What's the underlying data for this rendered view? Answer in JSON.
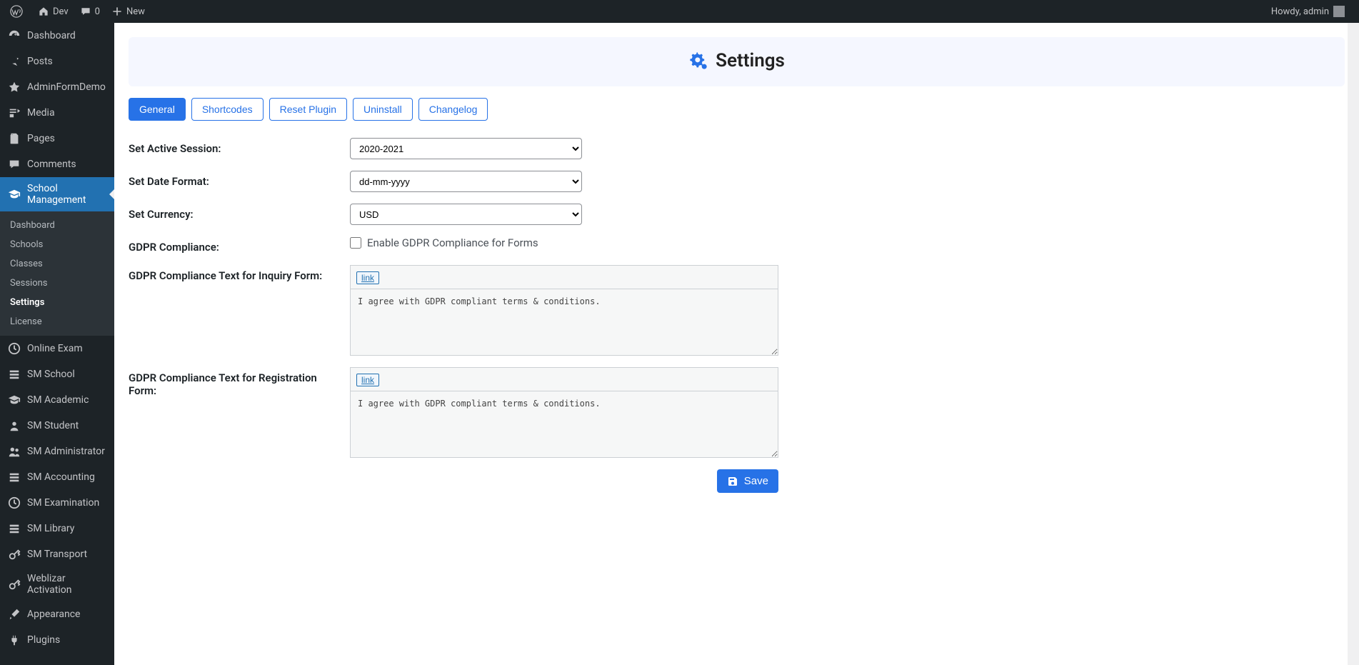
{
  "adminbar": {
    "site_name": "Dev",
    "comments_count": "0",
    "new_label": "New",
    "howdy": "Howdy, admin"
  },
  "sidebar": {
    "items": [
      {
        "label": "Dashboard",
        "icon": "gauge"
      },
      {
        "label": "Posts",
        "icon": "pin"
      },
      {
        "label": "AdminFormDemo",
        "icon": "star"
      },
      {
        "label": "Media",
        "icon": "media"
      },
      {
        "label": "Pages",
        "icon": "pages"
      },
      {
        "label": "Comments",
        "icon": "comment"
      },
      {
        "label": "School Management",
        "icon": "grad-cap",
        "active": true
      },
      {
        "label": "Online Exam",
        "icon": "clock"
      },
      {
        "label": "SM School",
        "icon": "list"
      },
      {
        "label": "SM Academic",
        "icon": "grad-cap"
      },
      {
        "label": "SM Student",
        "icon": "user"
      },
      {
        "label": "SM Administrator",
        "icon": "users"
      },
      {
        "label": "SM Accounting",
        "icon": "list"
      },
      {
        "label": "SM Examination",
        "icon": "clock"
      },
      {
        "label": "SM Library",
        "icon": "list"
      },
      {
        "label": "SM Transport",
        "icon": "key"
      },
      {
        "label": "Weblizar Activation",
        "icon": "key"
      },
      {
        "label": "Appearance",
        "icon": "brush"
      },
      {
        "label": "Plugins",
        "icon": "plug"
      }
    ],
    "submenu": [
      {
        "label": "Dashboard"
      },
      {
        "label": "Schools"
      },
      {
        "label": "Classes"
      },
      {
        "label": "Sessions"
      },
      {
        "label": "Settings",
        "current": true
      },
      {
        "label": "License"
      }
    ]
  },
  "page": {
    "title": "Settings"
  },
  "tabs": [
    {
      "label": "General",
      "active": true
    },
    {
      "label": "Shortcodes"
    },
    {
      "label": "Reset Plugin"
    },
    {
      "label": "Uninstall"
    },
    {
      "label": "Changelog"
    }
  ],
  "form": {
    "active_session_label": "Set Active Session:",
    "active_session_value": "2020-2021",
    "date_format_label": "Set Date Format:",
    "date_format_value": "dd-mm-yyyy",
    "currency_label": "Set Currency:",
    "currency_value": "USD",
    "gdpr_label": "GDPR Compliance:",
    "gdpr_checkbox_label": "Enable GDPR Compliance for Forms",
    "gdpr_checked": false,
    "gdpr_inquiry_label": "GDPR Compliance Text for Inquiry Form:",
    "gdpr_inquiry_text": "I agree with GDPR compliant terms & conditions.",
    "gdpr_registration_label": "GDPR Compliance Text for Registration Form:",
    "gdpr_registration_text": "I agree with GDPR compliant terms & conditions.",
    "link_btn_label": "link",
    "save_label": "Save"
  }
}
